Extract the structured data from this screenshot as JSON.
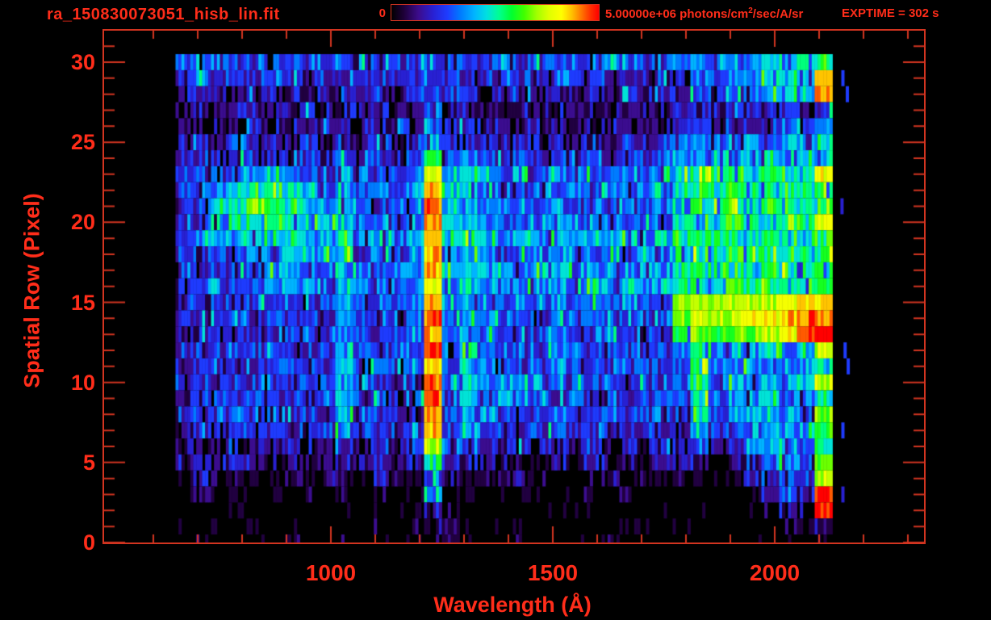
{
  "header": {
    "title": "ra_150830073051_hisb_lin.fit",
    "colorbar_min_label": "0",
    "colorbar_max_label": {
      "prefix": "5.00000e+06 photons/cm",
      "sup": "2",
      "suffix": "/sec/A/sr"
    },
    "exptime_label": "EXPTIME = 302 s"
  },
  "colors": {
    "text_red": "#ff2d1a",
    "axis_red": "#d23420",
    "background": "#000000"
  },
  "chart_data": {
    "type": "heatmap",
    "title": "ra_150830073051_hisb_lin.fit",
    "xlabel": "Wavelength (Å)",
    "ylabel": "Spatial Row (Pixel)",
    "x_axis": {
      "unit": "Angstrom",
      "min": 485,
      "max": 2340,
      "major_ticks": [
        1000,
        1500,
        2000
      ],
      "minor_step": 100
    },
    "y_axis": {
      "unit": "pixel row",
      "min": 0,
      "max": 32,
      "major_ticks": [
        0,
        5,
        10,
        15,
        20,
        25,
        30
      ],
      "minor_step": 1
    },
    "colorbar": {
      "min": 0,
      "max": 5000000,
      "units": "photons/cm^2/sec/A/sr",
      "gradient_stops": [
        {
          "t": 0,
          "c": "#000000"
        },
        {
          "t": 0.06,
          "c": "#1e0038"
        },
        {
          "t": 0.13,
          "c": "#3c0c8c"
        },
        {
          "t": 0.2,
          "c": "#2820d2"
        },
        {
          "t": 0.27,
          "c": "#1e3cff"
        },
        {
          "t": 0.33,
          "c": "#0078ff"
        },
        {
          "t": 0.4,
          "c": "#00b4ff"
        },
        {
          "t": 0.46,
          "c": "#00e0e0"
        },
        {
          "t": 0.52,
          "c": "#00ff90"
        },
        {
          "t": 0.58,
          "c": "#00ff30"
        },
        {
          "t": 0.64,
          "c": "#40ff00"
        },
        {
          "t": 0.7,
          "c": "#a0ff00"
        },
        {
          "t": 0.76,
          "c": "#e0ff00"
        },
        {
          "t": 0.82,
          "c": "#ffff00"
        },
        {
          "t": 0.87,
          "c": "#ffc000"
        },
        {
          "t": 0.92,
          "c": "#ff7000"
        },
        {
          "t": 0.96,
          "c": "#ff3000"
        },
        {
          "t": 1,
          "c": "#ff0000"
        }
      ]
    },
    "exposure_seconds": 302,
    "grid": {
      "description": "Coarse 16-level (hex 0-f, 0=black .. f=red=5e6) intensity map of the spectral image. Rows listed top-to-bottom from spatial row 30 down to row 0. Each row string = 14 dash-separated column segments spanning wavelengths 650-2130 A in 40 A columns (37 columns total). Features: Ly-beta 1026 line (col 9), bright Ly-alpha 1216 line (col 14), OI 1304 (col 16), OI 1356 (col 17), NI 1493 (col 21), LBH band 1830 (col 29), broad bright band 1780-2100 with yellow-orange rows 13-15, red hot edge column 2090-2130, green blob 800-950 at rows 20-23.",
      "lambda_start": 650,
      "lambda_step": 40,
      "first_row": 30,
      "rows": [
        "444344444-4-4344-4-4-4-3-444-4-434444-5-5-555677-8",
        "343334333-3-3333-4-3-3-3-333-3-333333-4-5-456786-d",
        "232232322-3-2323-4-3-3-2-232-3-232323-3-4-345675-e",
        "222322232-2-2222-4-2-2-2-222-2-222222-3-3-233332-4",
        "222232223-2-2232-5-2-3-2-222-2-222222-3-3-233443-5",
        "232323232-3-2323-6-3-3-3-232-3-232323-4-5-445554-6",
        "333433343-4-3434-9-5-5-4-343-4-343434-5-6-556655-7",
        "344456544-6-4445-c-6-7-5-454-5-454545-7-8-887988-c",
        "345778765-6-4545-d-7-7-5-545-5-545454-7-8-798788-8",
        "3467a9875-6-5454-e-7-6-5-454-5-454545-7-8-887987-8",
        "345789766-6-4545-e-6-6-5-545-5-545454-7-8-798788-c",
        "456667766-7-5656-d-6-8-6-565-6-565656-7-8-887987-8",
        "344455666-7-4545-d-5-6-5-454-5-545454-7-8-798877-8",
        "334456654-6-5455-d-6-6-6-656-6-656565-7-8-887987-8",
        "334445554-6-5545-c-5-6-6-565-6-565656-7-8-798877-9",
        "334344434-6-4445-d-5-6-5-454-5-454545-a-b-bbbbcc-d",
        "333434343-6-4344-e-5-5-5-444-5-444444-a-b-bbccde-e",
        "233333433-5-4334-d-4-6-5-434-5-434343-8-a-9aabce-f",
        "333434334-6-4344-e-4-7-5-444-5-434434-5-8-565656-b",
        "233333433-6-3434-d-4-6-5-434-5-434343-4-8-556565-7",
        "333433343-6-4343-e-4-7-5-665-5-434343-4-8-465656-b",
        "233333333-6-3434-e-4-6-4-654-4-434334-4-7-455645-8",
        "333433333-6-3433-d-4-5-4-434-4-334343-4-7-456564-a",
        "232333233-5-3333-d-3-5-4-333-4-333333-3-6-345656-9",
        "222322322-3-2323-b-3-4-3-232-3-232323-3-4-235665-8",
        "222222222-2-2222-8-3-2-2-222-2-122212-2-2-123454-9",
        "121211212-2-1212-4-2-1-1-121-1-112111-1-1-012343-b",
        "010101010-1-0101-6-1-1-0-010-0-010100-0-0-001233-f",
        "000100000-0-0010-2-1-0-0-000-0-000000-0-0-000122-f",
        "000010000-0-0101-2-1-0-0-000-0-000100-0-0-000011-2",
        "010000100-1-0001-1-1-0-0-010-0-001000-0-0-000000-1"
      ]
    },
    "stray_pixels": [
      {
        "row": 29,
        "lambda": 2150,
        "level": 4
      },
      {
        "row": 28,
        "lambda": 2160,
        "level": 4
      },
      {
        "row": 21,
        "lambda": 2148,
        "level": 3
      },
      {
        "row": 12,
        "lambda": 2155,
        "level": 4
      },
      {
        "row": 11,
        "lambda": 2162,
        "level": 4
      },
      {
        "row": 7,
        "lambda": 2150,
        "level": 4
      },
      {
        "row": 3,
        "lambda": 2150,
        "level": 3
      }
    ]
  }
}
